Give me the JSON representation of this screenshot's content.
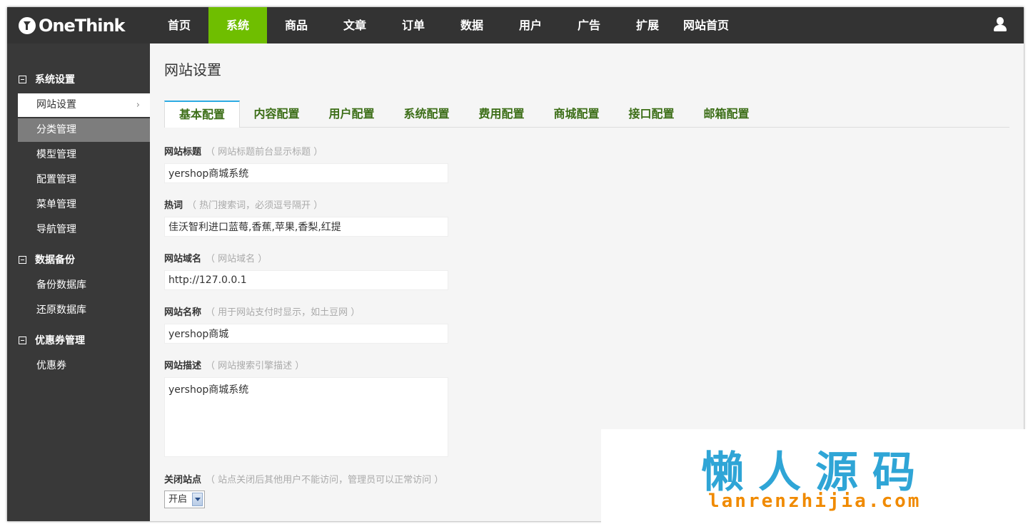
{
  "logo": {
    "text": "OneThink"
  },
  "nav": {
    "items": [
      {
        "label": "首页"
      },
      {
        "label": "系统"
      },
      {
        "label": "商品"
      },
      {
        "label": "文章"
      },
      {
        "label": "订单"
      },
      {
        "label": "数据"
      },
      {
        "label": "用户"
      },
      {
        "label": "广告"
      },
      {
        "label": "扩展"
      },
      {
        "label": "网站首页"
      }
    ],
    "active_index": 1,
    "active_color": "#6fbe00"
  },
  "sidebar": {
    "groups": [
      {
        "title": "系统设置",
        "items": [
          "网站设置",
          "分类管理",
          "模型管理",
          "配置管理",
          "菜单管理",
          "导航管理"
        ]
      },
      {
        "title": "数据备份",
        "items": [
          "备份数据库",
          "还原数据库"
        ]
      },
      {
        "title": "优惠券管理",
        "items": [
          "优惠券"
        ]
      }
    ],
    "chevron": "›"
  },
  "main": {
    "title": "网站设置",
    "tabs": [
      "基本配置",
      "内容配置",
      "用户配置",
      "系统配置",
      "费用配置",
      "商城配置",
      "接口配置",
      "邮箱配置"
    ],
    "fields": [
      {
        "label": "网站标题",
        "hint": "（ 网站标题前台显示标题 ）",
        "value": "yershop商城系统"
      },
      {
        "label": "热词",
        "hint": "（ 热门搜索词，必须逗号隔开 ）",
        "value": "佳沃智利进口蓝莓,香蕉,苹果,香梨,红提"
      },
      {
        "label": "网站域名",
        "hint": "（ 网站域名 ）",
        "value": "http://127.0.0.1"
      },
      {
        "label": "网站名称",
        "hint": "（ 用于网站支付时显示，如土豆网 ）",
        "value": "yershop商城"
      },
      {
        "label": "网站描述",
        "hint": "（ 网站搜索引擎描述 ）",
        "value": "yershop商城系统"
      },
      {
        "label": "关闭站点",
        "hint": "（ 站点关闭后其他用户不能访问，管理员可以正常访问 ）",
        "value": "开启"
      }
    ]
  },
  "watermark": {
    "cn": "懒人源码",
    "en": "lanrenzhijia.com"
  },
  "colors": {
    "topbar": "#333333",
    "sidebar": "#393939",
    "tab_text": "#3c6e17",
    "tab_active_border": "#2cabe3"
  }
}
